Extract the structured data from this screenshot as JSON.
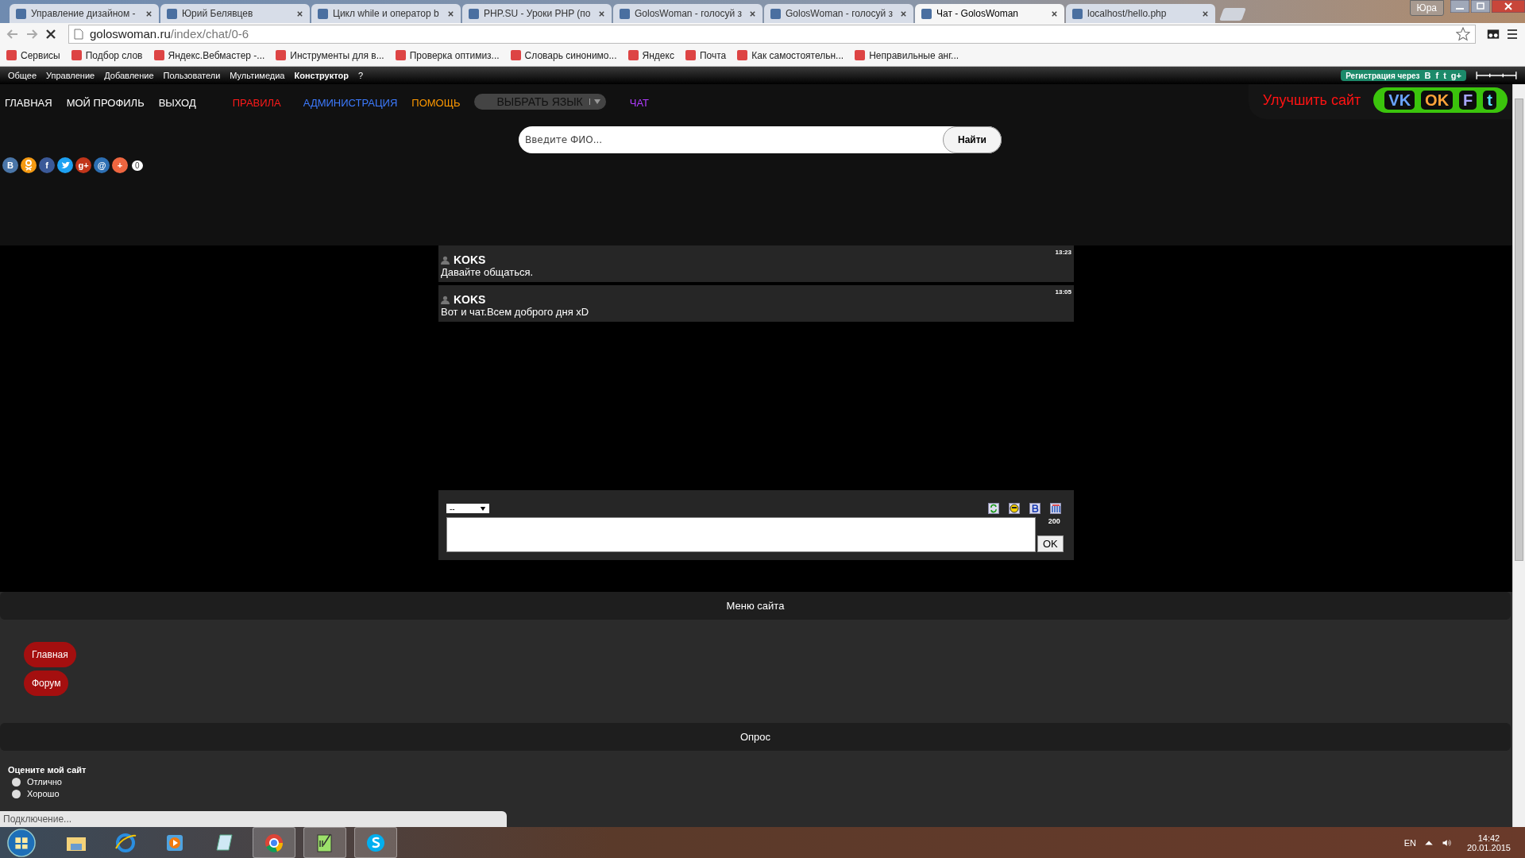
{
  "browser": {
    "tabs": [
      {
        "title": "Управление дизайном -",
        "selected": false
      },
      {
        "title": "Юрий Белявцев",
        "selected": false
      },
      {
        "title": "Цикл while и оператор b",
        "selected": false
      },
      {
        "title": "PHP.SU - Уроки PHP (по",
        "selected": false
      },
      {
        "title": "GolosWoman - голосуй з",
        "selected": false
      },
      {
        "title": "GolosWoman - голосуй з",
        "selected": false
      },
      {
        "title": "Чат - GolosWoman",
        "selected": true
      },
      {
        "title": "localhost/hello.php",
        "selected": false
      }
    ],
    "user": "Юра",
    "address": {
      "host": "goloswoman.ru",
      "path": "/index/chat/0-6"
    },
    "bookmarks": [
      "Сервисы",
      "Подбор слов",
      "Яндекс.Вебмастер -...",
      "Инструменты для в...",
      "Проверка оптимиз...",
      "Словарь синонимо...",
      "Яндекс",
      "Почта",
      "Как самостоятельн...",
      "Неправильные анг..."
    ]
  },
  "admin_bar": {
    "items": [
      {
        "label": "Общее",
        "bold": false
      },
      {
        "label": "Управление",
        "bold": false
      },
      {
        "label": "Добавление",
        "bold": false
      },
      {
        "label": "Пользователи",
        "bold": false
      },
      {
        "label": "Мультимедиа",
        "bold": false
      },
      {
        "label": "Конструктор",
        "bold": true
      },
      {
        "label": "?",
        "bold": false
      }
    ],
    "register": "Регистрация через",
    "register_icons": [
      "В",
      "f",
      "t",
      "g+"
    ]
  },
  "nav": {
    "items": [
      {
        "label": "ГЛАВНАЯ",
        "color": "#ffffff"
      },
      {
        "label": "МОЙ ПРОФИЛЬ",
        "color": "#ffffff"
      },
      {
        "label": "ВЫХОД",
        "color": "#ffffff"
      },
      {
        "label": "ПРАВИЛА",
        "color": "#ff1a1a"
      },
      {
        "label": "АДМИНИСТРАЦИЯ",
        "color": "#3d7bff"
      },
      {
        "label": "ПОМОЩЬ",
        "color": "#ff9900"
      }
    ],
    "language": "ВЫБРАТЬ ЯЗЫК",
    "chat": {
      "label": "ЧАТ",
      "color": "#b13cff"
    },
    "improve": "Улучшить сайт",
    "social_pill": [
      "VK",
      "OK",
      "F",
      "t"
    ]
  },
  "search": {
    "placeholder": "Введите ФИО...",
    "button": "Найти"
  },
  "share": {
    "icons": [
      {
        "kind": "glyph",
        "glyph": "В",
        "color": "#4a76a8"
      },
      {
        "kind": "person",
        "color": "#f59a12"
      },
      {
        "kind": "glyph",
        "glyph": "f",
        "color": "#3b5998"
      },
      {
        "kind": "bird",
        "color": "#1da1f2"
      },
      {
        "kind": "glyph",
        "glyph": "g+",
        "color": "#c1351a"
      },
      {
        "kind": "glyph",
        "glyph": "@",
        "color": "#2d6fb3"
      },
      {
        "kind": "glyph",
        "glyph": "+",
        "color": "#ee6640"
      }
    ],
    "count": "0"
  },
  "chat": {
    "messages": [
      {
        "user": "KOKS",
        "time": "13:23",
        "text": "Давайте общаться."
      },
      {
        "user": "KOKS",
        "time": "13:05",
        "text": "Вот и чат.Всем доброго дня xD"
      }
    ],
    "select": "--",
    "counter": "200",
    "send": "OK"
  },
  "menu": {
    "title": "Меню сайта",
    "buttons": [
      "Главная",
      "Форум"
    ]
  },
  "poll": {
    "title": "Опрос",
    "question": "Оцените мой сайт",
    "options": [
      {
        "label": "Отлично",
        "selected": false
      },
      {
        "label": "Хорошо",
        "selected": false
      }
    ]
  },
  "status": "Подключение...",
  "taskbar": {
    "apps": [
      {
        "kind": "folder",
        "active": false
      },
      {
        "kind": "globe",
        "active": false
      },
      {
        "kind": "player",
        "active": false
      },
      {
        "kind": "notepad",
        "active": false
      },
      {
        "kind": "chrome",
        "active": true
      },
      {
        "kind": "editor",
        "active": true
      },
      {
        "kind": "chat",
        "active": true
      }
    ],
    "language": "EN",
    "time": "14:42",
    "date": "20.01.2015"
  }
}
